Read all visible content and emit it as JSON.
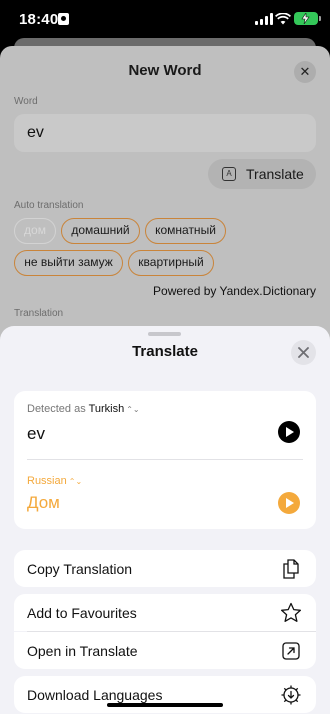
{
  "status_bar": {
    "time": "18:40"
  },
  "background_sheet": {
    "title": "New Word",
    "word_label": "Word",
    "word_value": "ev",
    "translate_button": "Translate",
    "auto_translation_label": "Auto translation",
    "suggestions": [
      "дом",
      "домашний",
      "комнатный",
      "не выйти замуж",
      "квартирный"
    ],
    "powered_by": "Powered by Yandex.Dictionary",
    "translation_label": "Translation"
  },
  "sheet": {
    "title": "Translate",
    "source": {
      "detected_prefix": "Detected as",
      "language": "Turkish",
      "text": "ev"
    },
    "target": {
      "language": "Russian",
      "text": "Дом"
    },
    "actions": {
      "copy": "Copy Translation",
      "favourites": "Add to Favourites",
      "open": "Open in Translate",
      "download": "Download Languages"
    }
  },
  "colors": {
    "accent": "#f4a93c",
    "chip_border": "#c9843a",
    "battery": "#34c759",
    "sheet_bg": "#f2f2f7"
  },
  "icons": [
    "lock-icon",
    "signal-icon",
    "wifi-icon",
    "battery-icon",
    "close-icon",
    "translate-icon",
    "play-icon",
    "copy-icon",
    "star-icon",
    "open-external-icon",
    "download-gear-icon",
    "chevron-updown-icon"
  ]
}
